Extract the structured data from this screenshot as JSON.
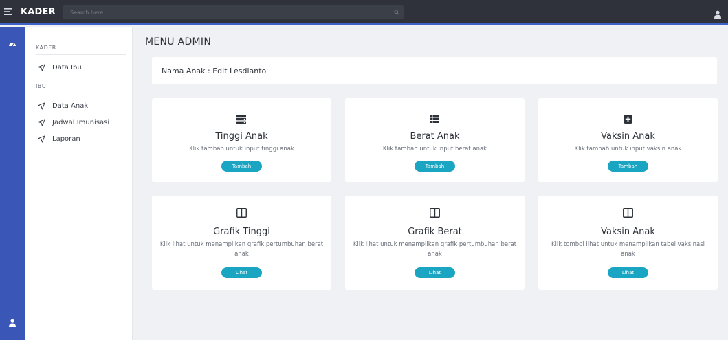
{
  "topbar": {
    "brand": "KADER",
    "search_placeholder": "Search here..."
  },
  "sidebar": {
    "section_kader": "KADER",
    "section_ibu": "IBU",
    "items": [
      {
        "label": "Data Ibu"
      },
      {
        "label": "Data Anak"
      },
      {
        "label": "Jadwal Imunisasi"
      },
      {
        "label": "Laporan"
      }
    ]
  },
  "main": {
    "title": "MENU ADMIN",
    "child_name": "Nama Anak : Edit Lesdianto",
    "cards": [
      {
        "icon": "server-icon",
        "title": "Tinggi Anak",
        "desc": "Klik tambah untuk input tinggi anak",
        "button": "Tambah"
      },
      {
        "icon": "list-icon",
        "title": "Berat Anak",
        "desc": "Klik tambah untuk input berat anak",
        "button": "Tambah"
      },
      {
        "icon": "plus-square-icon",
        "title": "Vaksin Anak",
        "desc": "Klik tambah untuk input vaksin anak",
        "button": "Tambah"
      },
      {
        "icon": "columns-icon",
        "title": "Grafik Tinggi",
        "desc": "Klik lihat untuk menampilkan grafik pertumbuhan berat anak",
        "button": "Lihat"
      },
      {
        "icon": "columns-icon",
        "title": "Grafik Berat",
        "desc": "Klik lihat untuk menampilkan grafik pertumbuhan berat anak",
        "button": "Lihat"
      },
      {
        "icon": "columns-icon",
        "title": "Vaksin Anak",
        "desc": "Klik tombol lihat untuk menampilkan tabel vaksinasi anak",
        "button": "Lihat"
      }
    ]
  },
  "colors": {
    "topbar": "#2f323a",
    "rail": "#3a57b8",
    "accent_line": "#3d63c9",
    "button": "#1aa5c2",
    "background": "#f0f1f4"
  }
}
